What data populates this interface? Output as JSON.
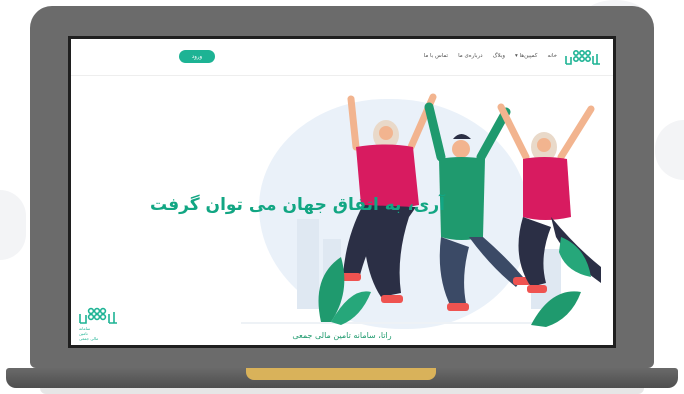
{
  "site": {
    "nav": [
      "خانه",
      "کمپین‌ها",
      "وبلاگ",
      "درباره‌ی ما",
      "تماس با ما"
    ],
    "nav_caret_item": "کمپین‌ها",
    "login_label": "ورود",
    "hero_title": "آری، به اتفاق جهان می توان گرفت",
    "tagline": "راتا، سامانه تامین مالی جمعی",
    "logo_caption": [
      "سامانه",
      "تامین",
      "مالی جمعی"
    ]
  },
  "colors": {
    "brand_green": "#1db394",
    "headline_green": "#12a683",
    "laptop_frame": "#6b6b6b",
    "laptop_hinge": "#d9b25a",
    "shirt_pink": "#d81b60",
    "shirt_green": "#1f9a6e",
    "pants_navy": "#2b2f45"
  },
  "icons": [
    "rata-logo-icon",
    "chevron-down-icon",
    "leaf-icon"
  ]
}
